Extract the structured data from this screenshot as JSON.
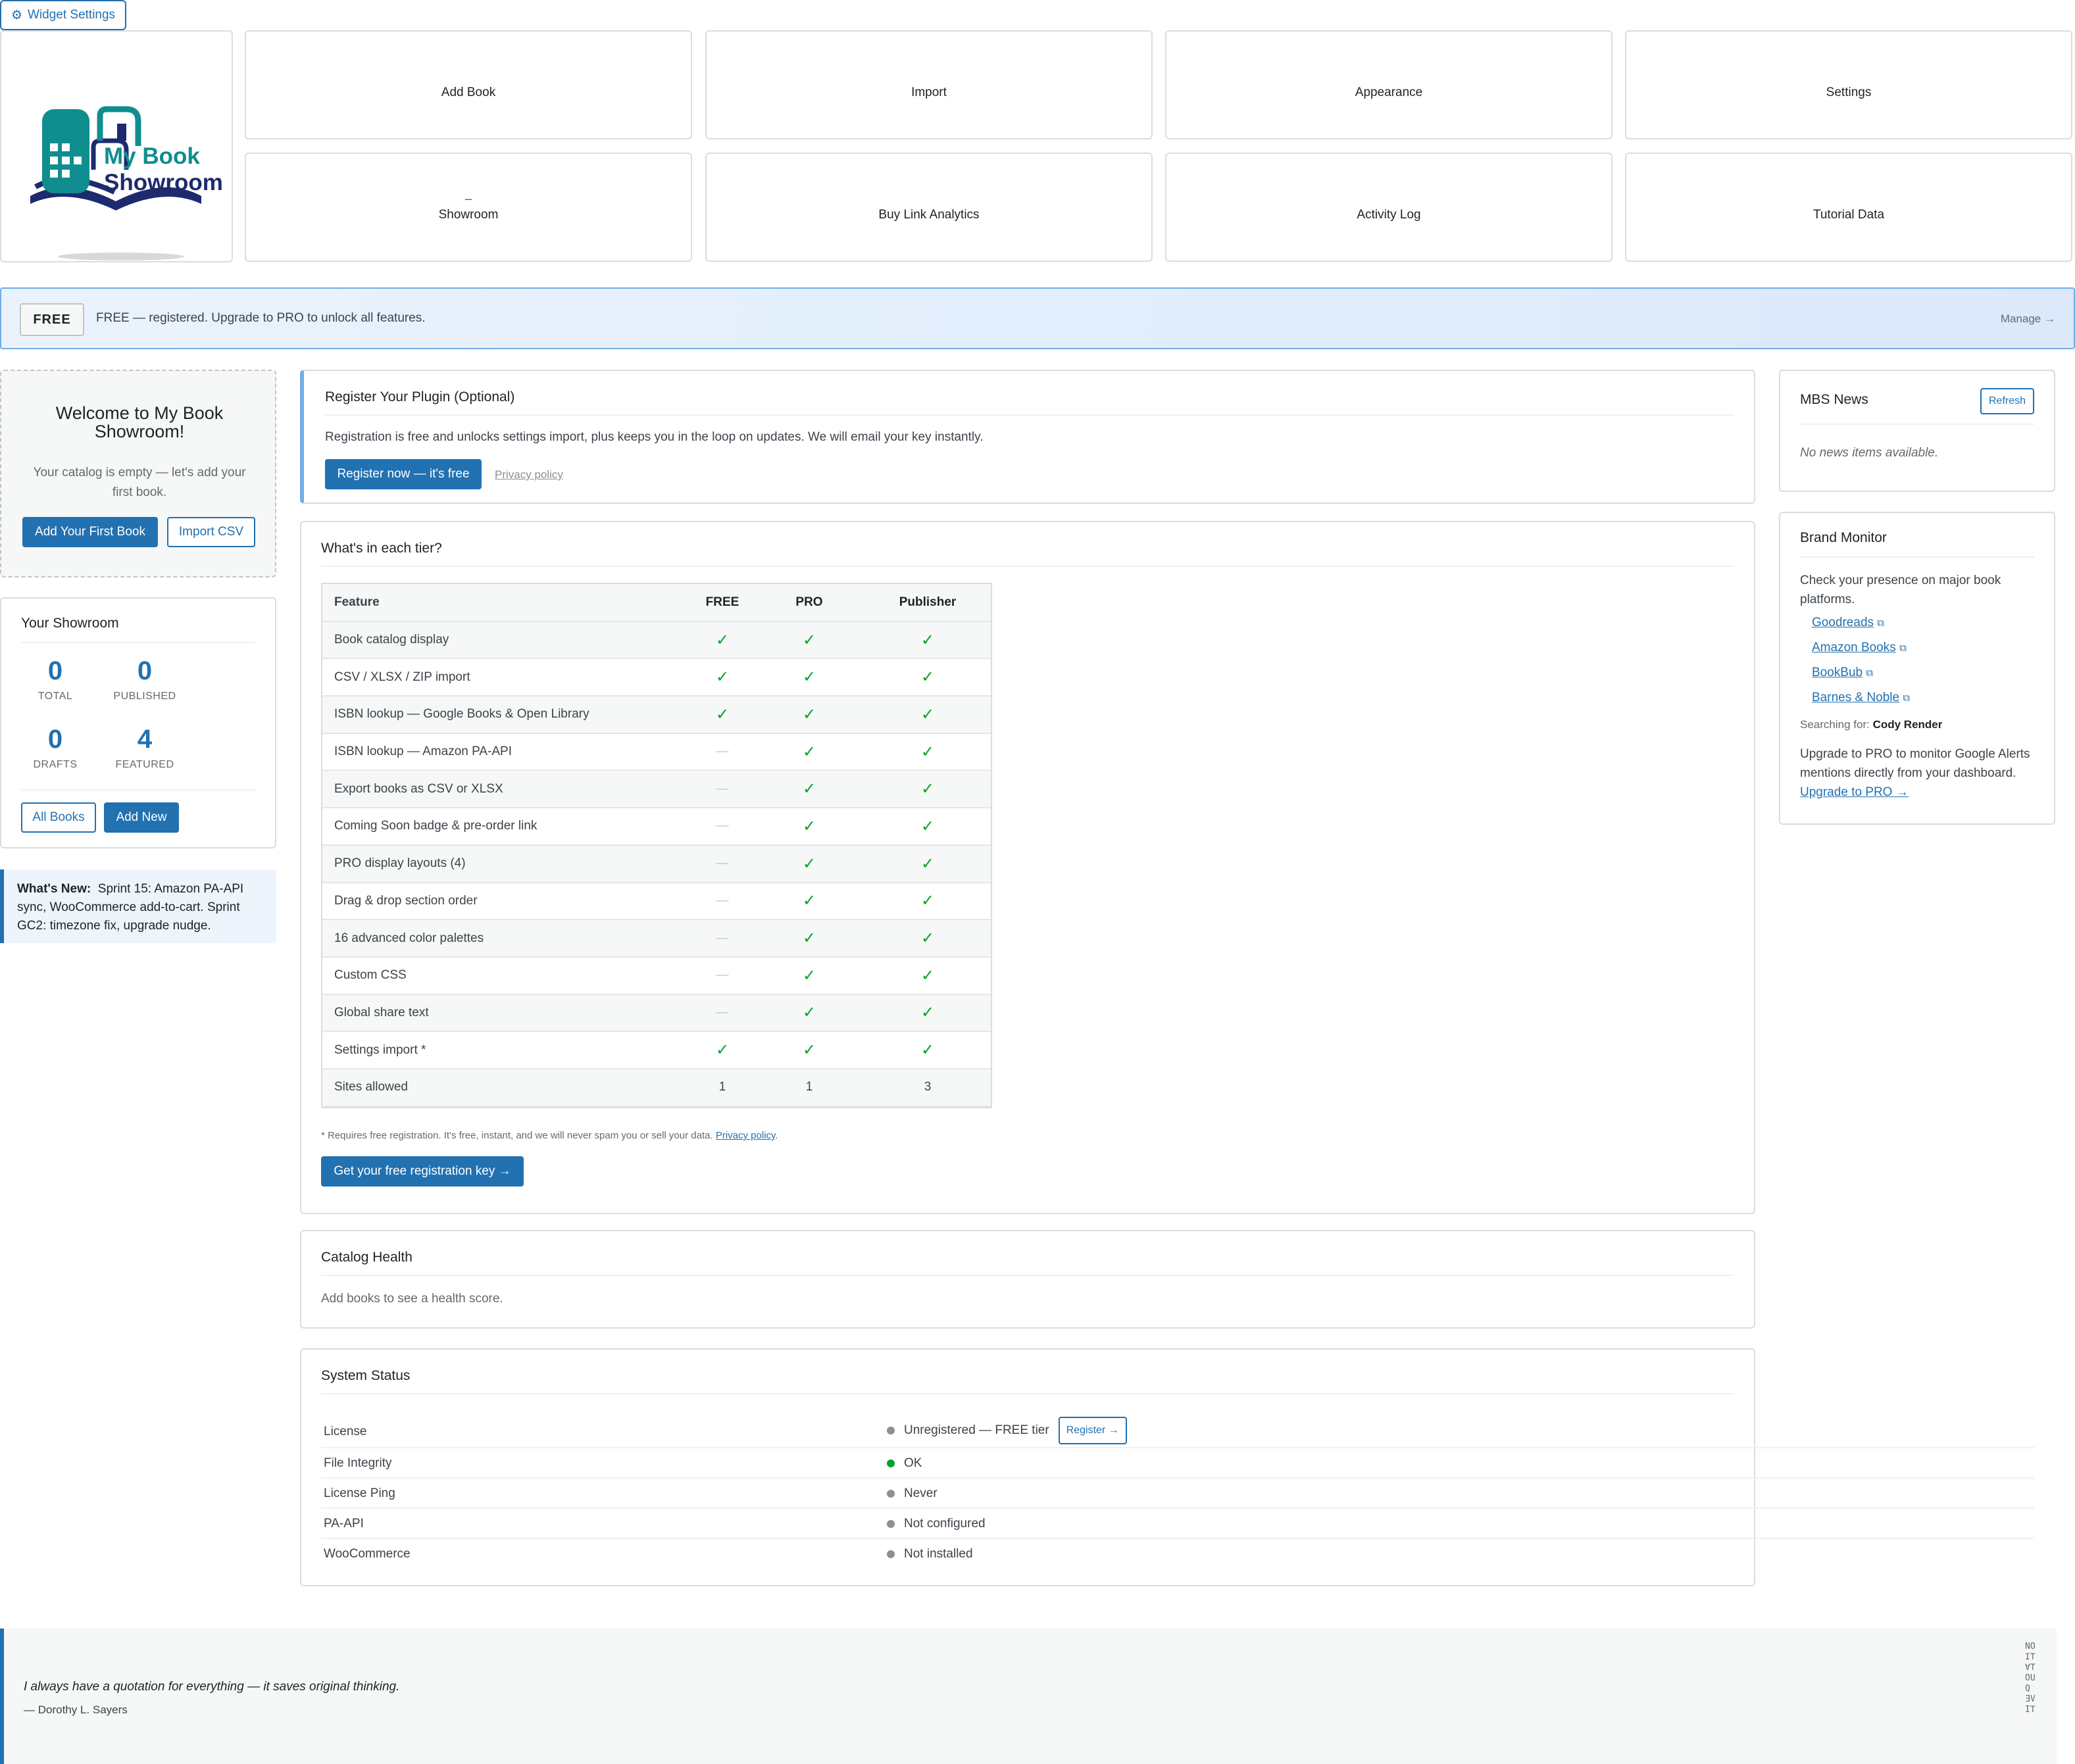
{
  "header": {
    "widget_settings": "Widget Settings",
    "logo": {
      "line1": "My Book",
      "line2": "Showroom"
    },
    "nav": [
      {
        "label": "Add Book",
        "icon": ""
      },
      {
        "label": "Import",
        "icon": ""
      },
      {
        "label": "Appearance",
        "icon": ""
      },
      {
        "label": "Settings",
        "icon": ""
      },
      {
        "label": "Showroom",
        "icon": "–"
      },
      {
        "label": "Buy Link Analytics",
        "icon": ""
      },
      {
        "label": "Activity Log",
        "icon": ""
      },
      {
        "label": "Tutorial Data",
        "icon": ""
      }
    ]
  },
  "license_banner": {
    "tier": "FREE",
    "text": "FREE — registered. Upgrade to PRO to unlock all features.",
    "manage": "Manage →"
  },
  "welcome": {
    "title": "Welcome to My Book Showroom!",
    "text": "Your catalog is empty — let's add your first book.",
    "add_first": "Add Your First Book",
    "import_csv": "Import CSV"
  },
  "showroom_stats": {
    "title": "Your Showroom",
    "stats": [
      {
        "value": "0",
        "label": "TOTAL"
      },
      {
        "value": "0",
        "label": "PUBLISHED"
      },
      {
        "value": "0",
        "label": "DRAFTS"
      },
      {
        "value": "4",
        "label": "FEATURED"
      }
    ],
    "all_books": "All Books",
    "add_new": "Add New"
  },
  "whats_new": {
    "label": "What's New:",
    "text": "Sprint 15: Amazon PA-API sync, WooCommerce add-to-cart. Sprint GC2: timezone fix, upgrade nudge."
  },
  "register": {
    "title": "Register Your Plugin (Optional)",
    "text": "Registration is free and unlocks settings import, plus keeps you in the loop on updates. We will email your key instantly.",
    "button": "Register now — it's free",
    "privacy": "Privacy policy"
  },
  "tiers": {
    "title": "What's in each tier?",
    "headers": [
      "Feature",
      "FREE",
      "PRO",
      "Publisher"
    ],
    "rows": [
      {
        "feature": "Book catalog display",
        "free": "✓",
        "pro": "✓",
        "pub": "✓"
      },
      {
        "feature": "CSV / XLSX / ZIP import",
        "free": "✓",
        "pro": "✓",
        "pub": "✓"
      },
      {
        "feature": "ISBN lookup — Google Books & Open Library",
        "free": "✓",
        "pro": "✓",
        "pub": "✓"
      },
      {
        "feature": "ISBN lookup — Amazon PA-API",
        "free": "—",
        "pro": "✓",
        "pub": "✓"
      },
      {
        "feature": "Export books as CSV or XLSX",
        "free": "—",
        "pro": "✓",
        "pub": "✓"
      },
      {
        "feature": "Coming Soon badge & pre-order link",
        "free": "—",
        "pro": "✓",
        "pub": "✓"
      },
      {
        "feature": "PRO display layouts (4)",
        "free": "—",
        "pro": "✓",
        "pub": "✓"
      },
      {
        "feature": "Drag & drop section order",
        "free": "—",
        "pro": "✓",
        "pub": "✓"
      },
      {
        "feature": "16 advanced color palettes",
        "free": "—",
        "pro": "✓",
        "pub": "✓"
      },
      {
        "feature": "Custom CSS",
        "free": "—",
        "pro": "✓",
        "pub": "✓"
      },
      {
        "feature": "Global share text",
        "free": "—",
        "pro": "✓",
        "pub": "✓"
      },
      {
        "feature": "Settings import *",
        "free": "✓",
        "pro": "✓",
        "pub": "✓"
      },
      {
        "feature": "Sites allowed",
        "free": "1",
        "pro": "1",
        "pub": "3"
      }
    ],
    "footnote": "* Requires free registration. It's free, instant, and we will never spam you or sell your data.",
    "footnote_link": "Privacy policy",
    "cta": "Get your free registration key →"
  },
  "catalog_health": {
    "title": "Catalog Health",
    "text": "Add books to see a health score."
  },
  "system_status": {
    "title": "System Status",
    "rows": [
      {
        "label": "License",
        "value": "Unregistered — FREE tier",
        "status": "grey",
        "action": "Register →"
      },
      {
        "label": "File Integrity",
        "value": "OK",
        "status": "green"
      },
      {
        "label": "License Ping",
        "value": "Never",
        "status": "grey"
      },
      {
        "label": "PA-API",
        "value": "Not configured",
        "status": "grey"
      },
      {
        "label": "WooCommerce",
        "value": "Not installed",
        "status": "grey"
      }
    ]
  },
  "news": {
    "title": "MBS News",
    "refresh": "Refresh",
    "empty": "No news items available."
  },
  "brand_monitor": {
    "title": "Brand Monitor",
    "text": "Check your presence on major book platforms.",
    "links": [
      "Goodreads",
      "Amazon Books",
      "BookBub",
      "Barnes & Noble"
    ],
    "searching_label": "Searching for:",
    "searching_name": "Cody Render",
    "upgrade_text": "Upgrade to PRO to monitor Google Alerts mentions directly from your dashboard.",
    "upgrade_link": "Upgrade to PRO →"
  },
  "quote": {
    "text": "I always have a quotation for everything — it saves original thinking.",
    "author": "— Dorothy L. Sayers",
    "side_label": "NOΙΤ∀ΤOUQ ƎVIΤ"
  },
  "colors": {
    "accent": "#2271b1",
    "success": "#00a32a",
    "muted": "#8c8f94",
    "banner_border": "#72aee6"
  }
}
